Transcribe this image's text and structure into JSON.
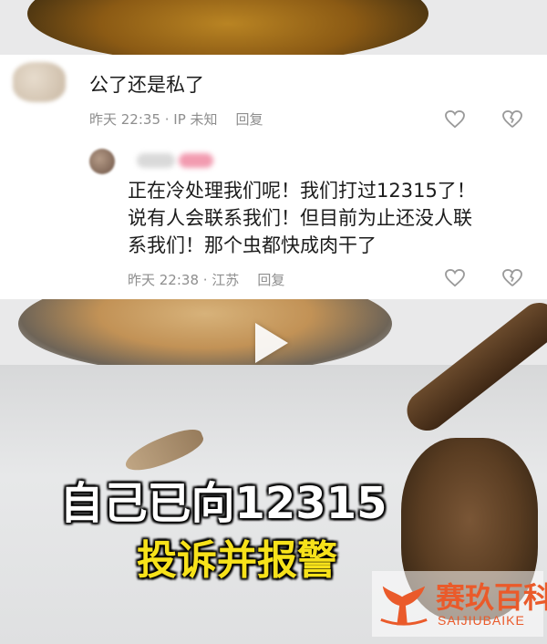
{
  "comments": [
    {
      "text": "公了还是私了",
      "time": "昨天 22:35 · IP 未知",
      "reply_label": "回复"
    },
    {
      "text": "正在冷处理我们呢！我们打过12315了！\n说有人会联系我们！但目前为止还没人联\n系我们！那个虫都快成肉干了",
      "time": "昨天 22:38 · 江苏",
      "reply_label": "回复"
    }
  ],
  "icons": {
    "like": "heart-outline-icon",
    "dislike": "broken-heart-icon",
    "play": "play-icon"
  },
  "video": {
    "caption_line1": "自己已向12315",
    "caption_line2": "投诉并报警",
    "caption_colors": {
      "line1": "#ffffff",
      "line2": "#f7e21a"
    }
  },
  "watermark": {
    "name_cn": "赛玖百科",
    "name_en": "SAIJIUBAIKE",
    "color": "#ea5a2a"
  }
}
